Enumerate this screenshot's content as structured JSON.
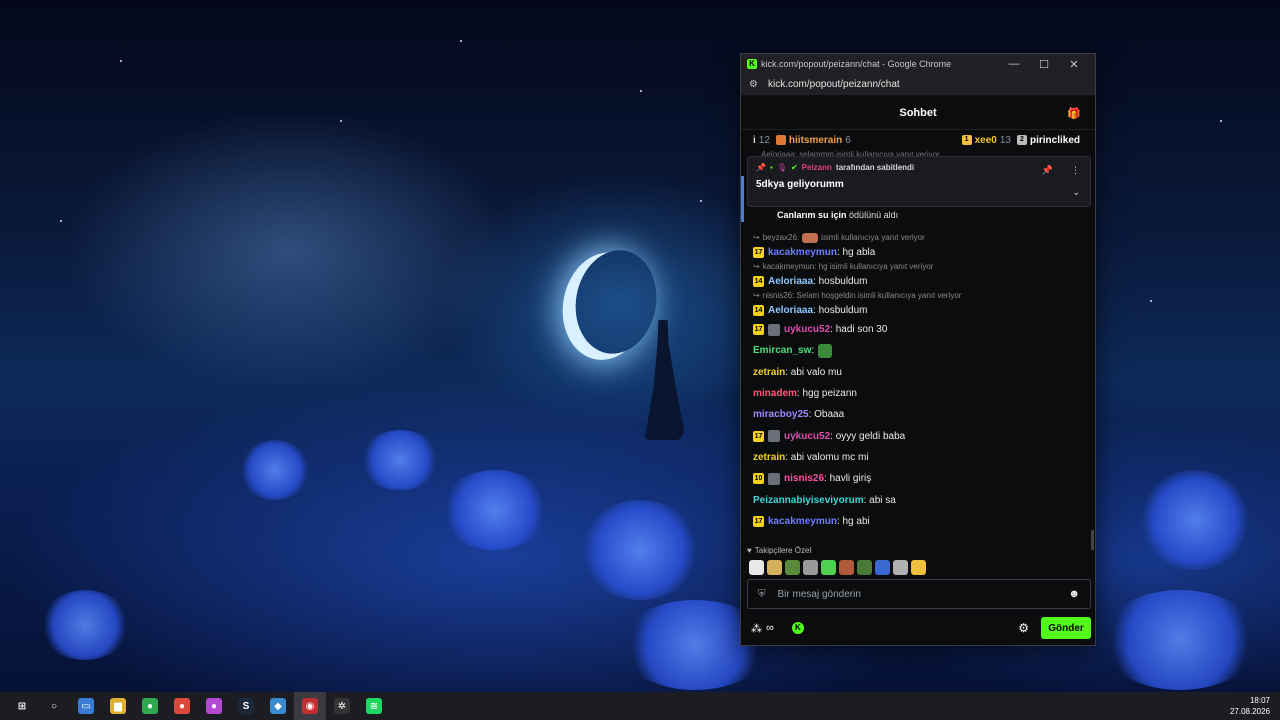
{
  "window": {
    "title": "kick.com/popout/peizann/chat - Google Chrome",
    "favicon": "K",
    "url": "kick.com/popout/peizann/chat"
  },
  "chat": {
    "header_title": "Sohbet",
    "leaderboard": [
      {
        "name": "i",
        "count": "12",
        "color": "#d7d7d7",
        "badge_color": "",
        "badge_text": ""
      },
      {
        "name": "hiitsmerain",
        "count": "6",
        "color": "#f0a050",
        "badge_color": "#e07a33",
        "badge_text": ""
      },
      {
        "name": "xee0",
        "count": "13",
        "color": "#f4c430",
        "badge_color": "#f4c430",
        "badge_text": "1"
      },
      {
        "name": "pirincliked",
        "count": "",
        "color": "#ffffff",
        "badge_color": "#bbbbbb",
        "badge_text": "2"
      }
    ],
    "reply_ghost": "Aeloriaaa: selammm isimli kullanıcıya yanıt veriyor",
    "pinned": {
      "author": "Peizann",
      "suffix": "tarafından sabitlendi",
      "message": "5dkya geliyorumm"
    },
    "behind_message": {
      "bold": "Canlarım su için",
      "rest": "ödülünü aldı"
    },
    "messages": [
      {
        "reply": "beyzax26:",
        "reply_rest": "isimli kullanıcıya yanıt veriyor",
        "badge": "17",
        "emote_badge": false,
        "user": "kacakmeymun",
        "user_color": "#6f7dff",
        "text": ": hg abla",
        "emote": ""
      },
      {
        "reply": "kacakmeymun: hg isimli kullanıcıya yanıt veriyor",
        "reply_rest": "",
        "badge": "14",
        "emote_badge": false,
        "user": "Aeloriaaa",
        "user_color": "#8fc7ff",
        "text": ": hosbuldum",
        "emote": ""
      },
      {
        "reply": "nisnis26: Selam hoşgeldin isimli kullanıcıya yanıt veriyor",
        "reply_rest": "",
        "badge": "14",
        "emote_badge": false,
        "user": "Aeloriaaa",
        "user_color": "#8fc7ff",
        "text": ": hosbuldum",
        "emote": ""
      },
      {
        "reply": "",
        "reply_rest": "",
        "badge": "17",
        "emote_badge": true,
        "user": "uykucu52",
        "user_color": "#e04bb0",
        "text": ": hadi son 30",
        "emote": ""
      },
      {
        "reply": "",
        "reply_rest": "",
        "badge": "",
        "emote_badge": false,
        "user": "Emircan_sw",
        "user_color": "#4fe07a",
        "text": ":",
        "emote": "#3a8a3a"
      },
      {
        "reply": "",
        "reply_rest": "",
        "badge": "",
        "emote_badge": false,
        "user": "zetrain",
        "user_color": "#f4d21a",
        "text": ": abi valo mu",
        "emote": ""
      },
      {
        "reply": "",
        "reply_rest": "",
        "badge": "",
        "emote_badge": false,
        "user": "minadem",
        "user_color": "#ff5a7a",
        "text": ": hgg peizann",
        "emote": ""
      },
      {
        "reply": "",
        "reply_rest": "",
        "badge": "",
        "emote_badge": false,
        "user": "miracboy25",
        "user_color": "#a18cff",
        "text": ": Obaaa",
        "emote": ""
      },
      {
        "reply": "",
        "reply_rest": "",
        "badge": "17",
        "emote_badge": true,
        "user": "uykucu52",
        "user_color": "#e04bb0",
        "text": ": oyyy geldi baba",
        "emote": ""
      },
      {
        "reply": "",
        "reply_rest": "",
        "badge": "",
        "emote_badge": false,
        "user": "zetrain",
        "user_color": "#f4d21a",
        "text": ": abi valomu mc mi",
        "emote": ""
      },
      {
        "reply": "",
        "reply_rest": "",
        "badge": "10",
        "emote_badge": true,
        "user": "nisnis26",
        "user_color": "#ff4fa0",
        "text": ": havli giriş",
        "emote": ""
      },
      {
        "reply": "",
        "reply_rest": "",
        "badge": "",
        "emote_badge": false,
        "user": "Peizannabiyiseviyorum",
        "user_color": "#3fd8d8",
        "text": ": abi sa",
        "emote": ""
      },
      {
        "reply": "",
        "reply_rest": "",
        "badge": "17",
        "emote_badge": false,
        "user": "kacakmeymun",
        "user_color": "#6f7dff",
        "text": ": hg abi",
        "emote": ""
      }
    ],
    "followers_label": "Takipçilere Özel",
    "emote_colors": [
      "#e8e8e8",
      "#d4b05a",
      "#5a8a3a",
      "#9a9a9a",
      "#4fd04f",
      "#b05a3a",
      "#4a7a3a",
      "#3a6ad0",
      "#b0b0b0",
      "#f0c040"
    ],
    "input_placeholder": "Bir mesaj gönderin",
    "infinity": "∞",
    "send_label": "Gönder"
  },
  "taskbar": {
    "time": "18:07",
    "date": "27.08.2026",
    "apps": [
      {
        "name": "start",
        "glyph": "⊞",
        "color": "transparent"
      },
      {
        "name": "search",
        "glyph": "○",
        "color": "transparent"
      },
      {
        "name": "task-view",
        "glyph": "▭",
        "color": "#3a7bd5"
      },
      {
        "name": "file-explorer",
        "glyph": "▆",
        "color": "#e0b030"
      },
      {
        "name": "chrome",
        "glyph": "●",
        "color": "#2fa84f"
      },
      {
        "name": "chrome-profile",
        "glyph": "●",
        "color": "#d94a3a"
      },
      {
        "name": "chrome-profile-2",
        "glyph": "●",
        "color": "#b04ad0"
      },
      {
        "name": "steam",
        "glyph": "S",
        "color": "#1b2838"
      },
      {
        "name": "network-app",
        "glyph": "◆",
        "color": "#3a8ad0"
      },
      {
        "name": "kick-app",
        "glyph": "◉",
        "color": "#c03030"
      },
      {
        "name": "steelseries",
        "glyph": "✲",
        "color": "#333"
      },
      {
        "name": "spotify",
        "glyph": "≋",
        "color": "#1ed760"
      }
    ]
  }
}
